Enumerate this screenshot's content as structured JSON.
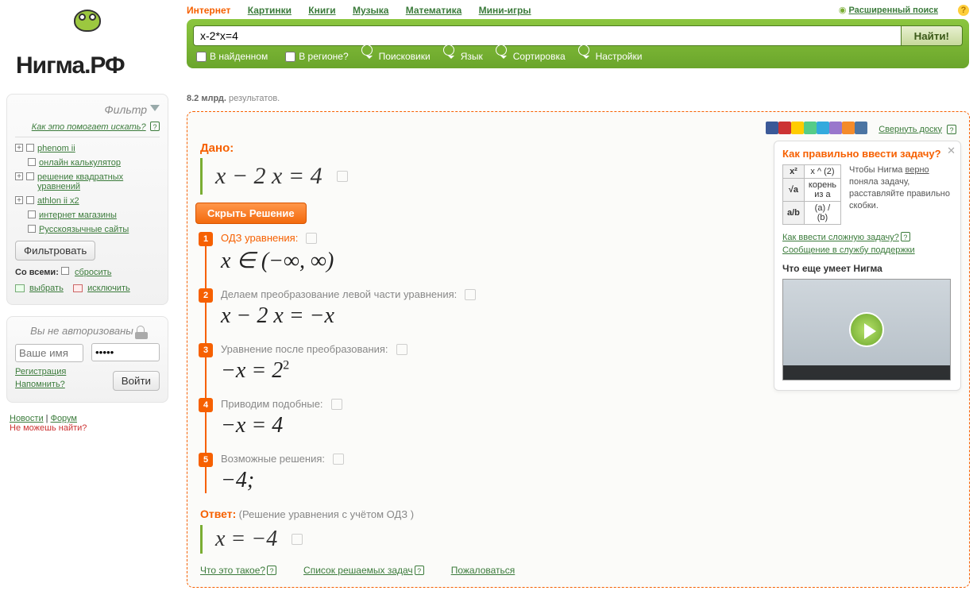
{
  "logo_text": "Нигма.РФ",
  "tabs": {
    "internet": "Интернет",
    "images": "Картинки",
    "books": "Книги",
    "music": "Музыка",
    "math": "Математика",
    "games": "Мини-игры",
    "advanced": "Расширенный поиск"
  },
  "search": {
    "query": "x-2*x=4",
    "submit": "Найти!",
    "opts": {
      "in_found": "В найденном",
      "in_region": "В регионе?",
      "engines": "Поисковики",
      "lang": "Язык",
      "sort": "Сортировка",
      "settings": "Настройки"
    }
  },
  "results": {
    "count": "8.2 млрд.",
    "label": "результатов."
  },
  "filter": {
    "title": "Фильтр",
    "help": "Как это помогает искать?",
    "items": [
      "phenom ii",
      "онлайн калькулятор",
      "решение квадратных уравнений",
      "athlon ii x2",
      "интернет магазины",
      "Русскоязычные сайты"
    ],
    "btn": "Фильтровать",
    "all_label": "Со всеми:",
    "reset": "сбросить",
    "select": "выбрать",
    "exclude": "исключить"
  },
  "login": {
    "title": "Вы не авторизованы",
    "name_ph": "Ваше имя",
    "pass_value": "•••••",
    "register": "Регистрация",
    "remind": "Напомнить?",
    "submit": "Войти"
  },
  "bottom": {
    "news": "Новости",
    "forum": "Форум",
    "cantfind": "Не можешь найти?"
  },
  "board": {
    "collapse": "Свернуть доску",
    "given_label": "Дано:",
    "given_eq": "x − 2 x = 4",
    "hide_btn": "Скрыть Решение",
    "steps": [
      {
        "n": "1",
        "label": "ОДЗ уравнения:",
        "label_orange": true,
        "math": "x ∈  (−∞, ∞)"
      },
      {
        "n": "2",
        "label": "Делаем преобразование левой части уравнения:",
        "math": "x − 2 x = −x"
      },
      {
        "n": "3",
        "label": "Уравнение после преобразования:",
        "math": "−x = 2<span class='sup'>2</span>"
      },
      {
        "n": "4",
        "label": "Приводим подобные:",
        "math": "−x = 4"
      },
      {
        "n": "5",
        "label": "Возможные решения:",
        "math": "−4;"
      }
    ],
    "answer_label": "Ответ:",
    "answer_note": "(Решение уравнения с учётом ОДЗ )",
    "answer_eq": "x = −4",
    "foot": {
      "whatis": "Что это такое?",
      "list": "Список решаемых задач",
      "complain": "Пожаловаться"
    }
  },
  "helpbox": {
    "title": "Как правильно ввести задачу?",
    "rows": [
      {
        "k": "x²",
        "v": "x ^ (2)"
      },
      {
        "k": "√a",
        "v": "корень из a"
      },
      {
        "k": "a/b",
        "v": "(a) / (b)"
      }
    ],
    "text": "Чтобы Нигма <u>верно</u> поняла задачу, расставляйте правильно скобки.",
    "link1": "Как ввести сложную задачу?",
    "link2": "Сообщение в службу поддержки",
    "more_title": "Что еще умеет Нигма"
  },
  "share_colors": [
    "#3b5998",
    "#cc3333",
    "#ffcc00",
    "#55cc88",
    "#33aadd",
    "#9977cc",
    "#f48b2a",
    "#4c75a3"
  ]
}
